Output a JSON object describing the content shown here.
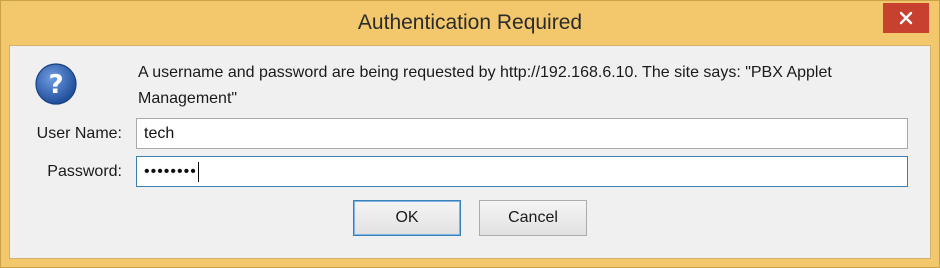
{
  "window": {
    "title": "Authentication Required"
  },
  "dialog": {
    "message": "A username and password are being requested by http://192.168.6.10. The site says: \"PBX Applet Management\"",
    "username_label": "User Name:",
    "username_value": "tech",
    "password_label": "Password:",
    "password_masked": "••••••••",
    "ok_label": "OK",
    "cancel_label": "Cancel"
  },
  "icons": {
    "question": "question-icon",
    "close": "close-icon"
  },
  "colors": {
    "frame": "#f3c86d",
    "close_button": "#c7412e",
    "focus_border": "#3c7fb1",
    "icon_blue": "#2f5fa8"
  }
}
